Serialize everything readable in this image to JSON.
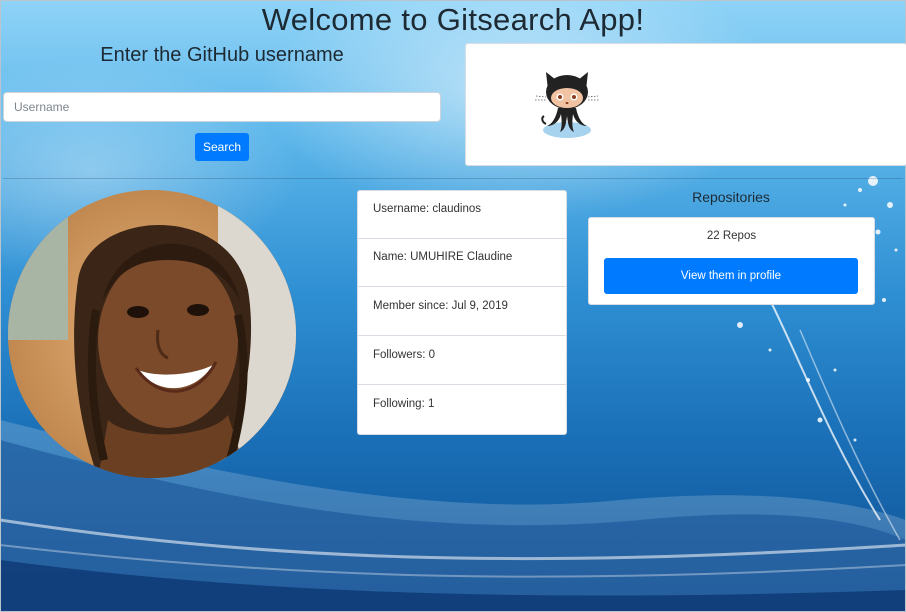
{
  "header": {
    "title": "Welcome to Gitsearch App!"
  },
  "search": {
    "heading": "Enter the GitHub username",
    "placeholder": "Username",
    "value": "",
    "button_label": "Search"
  },
  "logo": {
    "icon": "octocat-icon"
  },
  "profile": {
    "avatar": "avatar-photo",
    "rows": [
      {
        "text": "Username: claudinos"
      },
      {
        "text": "Name: UMUHIRE Claudine"
      },
      {
        "text": "Member since: Jul 9, 2019"
      },
      {
        "text": "Followers: 0"
      },
      {
        "text": "Following: 1"
      }
    ]
  },
  "repositories": {
    "heading": "Repositories",
    "count_text": "22 Repos",
    "button_label": "View them in profile"
  },
  "colors": {
    "accent": "#007bff",
    "background_top": "#8fd3f7",
    "background_bottom": "#0f4f93"
  }
}
